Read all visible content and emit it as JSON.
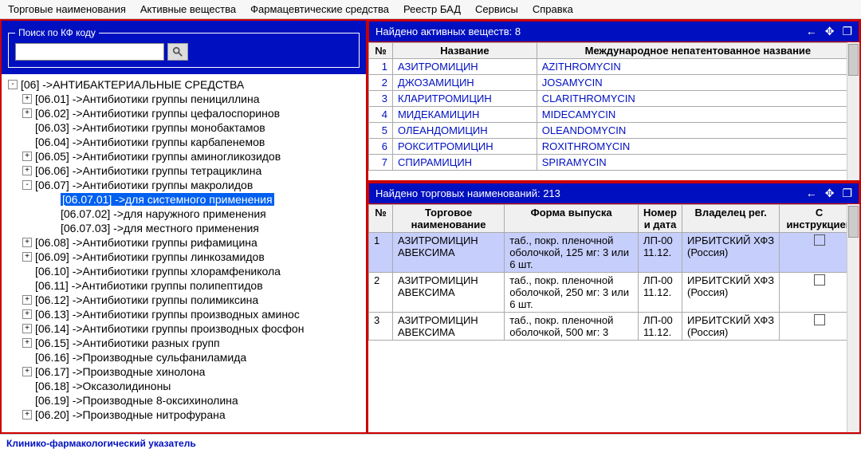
{
  "menubar": [
    "Торговые наименования",
    "Активные вещества",
    "Фармацевтические средства",
    "Реестр БАД",
    "Сервисы",
    "Справка"
  ],
  "search": {
    "legend": "Поиск по КФ коду",
    "value": ""
  },
  "tree": [
    {
      "lvl": 0,
      "exp": "-",
      "text": "[06] ->АНТИБАКТЕРИАЛЬНЫЕ СРЕДСТВА"
    },
    {
      "lvl": 1,
      "exp": "+",
      "text": "[06.01] ->Антибиотики группы пенициллина"
    },
    {
      "lvl": 1,
      "exp": "+",
      "text": "[06.02] ->Антибиотики группы цефалоспоринов"
    },
    {
      "lvl": 1,
      "exp": "",
      "text": "[06.03] ->Антибиотики группы монобактамов"
    },
    {
      "lvl": 1,
      "exp": "",
      "text": "[06.04] ->Антибиотики группы карбапенемов"
    },
    {
      "lvl": 1,
      "exp": "+",
      "text": "[06.05] ->Антибиотики группы аминогликозидов"
    },
    {
      "lvl": 1,
      "exp": "+",
      "text": "[06.06] ->Антибиотики группы тетрациклина"
    },
    {
      "lvl": 1,
      "exp": "-",
      "text": "[06.07] ->Антибиотики группы макролидов"
    },
    {
      "lvl": 2,
      "exp": "",
      "text": "[06.07.01] ->для системного применения",
      "sel": true
    },
    {
      "lvl": 2,
      "exp": "",
      "text": "[06.07.02] ->для наружного применения"
    },
    {
      "lvl": 2,
      "exp": "",
      "text": "[06.07.03] ->для местного применения"
    },
    {
      "lvl": 1,
      "exp": "+",
      "text": "[06.08] ->Антибиотики группы рифамицина"
    },
    {
      "lvl": 1,
      "exp": "+",
      "text": "[06.09] ->Антибиотики группы линкозамидов"
    },
    {
      "lvl": 1,
      "exp": "",
      "text": "[06.10] ->Антибиотики группы хлорамфеникола"
    },
    {
      "lvl": 1,
      "exp": "",
      "text": "[06.11] ->Антибиотики группы полипептидов"
    },
    {
      "lvl": 1,
      "exp": "+",
      "text": "[06.12] ->Антибиотики группы полимиксина"
    },
    {
      "lvl": 1,
      "exp": "+",
      "text": "[06.13] ->Антибиотики группы производных аминос"
    },
    {
      "lvl": 1,
      "exp": "+",
      "text": "[06.14] ->Антибиотики группы производных фосфон"
    },
    {
      "lvl": 1,
      "exp": "+",
      "text": "[06.15] ->Антибиотики разных групп"
    },
    {
      "lvl": 1,
      "exp": "",
      "text": "[06.16] ->Производные сульфаниламида"
    },
    {
      "lvl": 1,
      "exp": "+",
      "text": "[06.17] ->Производные хинолона"
    },
    {
      "lvl": 1,
      "exp": "",
      "text": "[06.18] ->Оксазолидиноны"
    },
    {
      "lvl": 1,
      "exp": "",
      "text": "[06.19] ->Производные 8-оксихинолина"
    },
    {
      "lvl": 1,
      "exp": "+",
      "text": "[06.20] ->Производные нитрофурана"
    }
  ],
  "topPanel": {
    "title": "Найдено активных веществ: 8",
    "cols": [
      "№",
      "Название",
      "Международное непатентованное название"
    ],
    "rows": [
      {
        "n": "1",
        "name": "АЗИТРОМИЦИН",
        "inn": "AZITHROMYCIN"
      },
      {
        "n": "2",
        "name": "ДЖОЗАМИЦИН",
        "inn": "JOSAMYCIN"
      },
      {
        "n": "3",
        "name": "КЛАРИТРОМИЦИН",
        "inn": "CLARITHROMYCIN"
      },
      {
        "n": "4",
        "name": "МИДЕКАМИЦИН",
        "inn": "MIDECAMYCIN"
      },
      {
        "n": "5",
        "name": "ОЛЕАНДОМИЦИН",
        "inn": "OLEANDOMYCIN"
      },
      {
        "n": "6",
        "name": "РОКСИТРОМИЦИН",
        "inn": "ROXITHROMYCIN"
      },
      {
        "n": "7",
        "name": "СПИРАМИЦИН",
        "inn": "SPIRAMYCIN"
      }
    ]
  },
  "botPanel": {
    "title": "Найдено торговых наименований: 213",
    "cols": [
      "№",
      "Торговое наименование",
      "Форма выпуска",
      "Номер и дата",
      "Владелец рег.",
      "С инструкцией"
    ],
    "rows": [
      {
        "n": "1",
        "name": "АЗИТРОМИЦИН АВЕКСИМА",
        "form": "таб., покр. пленочной оболочкой, 125 мг: 3 или 6 шт.",
        "num": "ЛП-00 11.12.",
        "owner": "ИРБИТСКИЙ ХФЗ (Россия)",
        "sel": true
      },
      {
        "n": "2",
        "name": "АЗИТРОМИЦИН АВЕКСИМА",
        "form": "таб., покр. пленочной оболочкой, 250 мг: 3 или 6 шт.",
        "num": "ЛП-00 11.12.",
        "owner": "ИРБИТСКИЙ ХФЗ (Россия)"
      },
      {
        "n": "3",
        "name": "АЗИТРОМИЦИН АВЕКСИМА",
        "form": "таб., покр. пленочной оболочкой, 500 мг: 3",
        "num": "ЛП-00 11.12.",
        "owner": "ИРБИТСКИЙ ХФЗ (Россия)"
      }
    ]
  },
  "status": "Клинико-фармакологический указатель"
}
